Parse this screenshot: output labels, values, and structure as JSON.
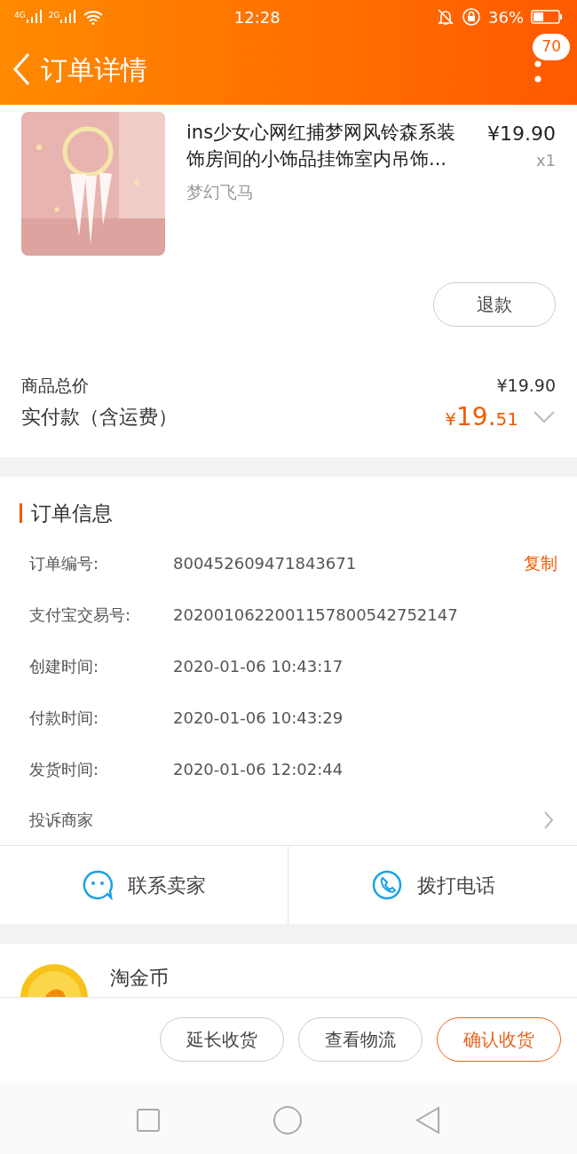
{
  "status_bar": {
    "network_1": "4G",
    "network_2": "2G",
    "time": "12:28",
    "battery": "36%"
  },
  "header": {
    "title": "订单详情",
    "badge": "70"
  },
  "product": {
    "title": "ins少女心网红捕梦网风铃森系装饰房间的小饰品挂饰室内吊饰...",
    "shop": "梦幻飞马",
    "price": "¥19.90",
    "quantity": "x1",
    "refund_button": "退款"
  },
  "totals": {
    "goods_label": "商品总价",
    "goods_value": "¥19.90",
    "paid_label": "实付款（含运费）",
    "paid_currency": "¥",
    "paid_integer": "19.",
    "paid_fraction": "51",
    "expanded": false
  },
  "order_info": {
    "title": "订单信息",
    "rows": [
      {
        "label": "订单编号:",
        "value": "800452609471843671",
        "action": "复制"
      },
      {
        "label": "支付宝交易号:",
        "value": "2020010622001157800542752147"
      },
      {
        "label": "创建时间:",
        "value": "2020-01-06 10:43:17"
      },
      {
        "label": "付款时间:",
        "value": "2020-01-06 10:43:29"
      },
      {
        "label": "发货时间:",
        "value": "2020-01-06 12:02:44"
      }
    ],
    "complaint": "投诉商家",
    "contacts": [
      {
        "kind": "chat",
        "label": "联系卖家"
      },
      {
        "kind": "phone",
        "label": "拨打电话"
      }
    ]
  },
  "coins": {
    "title": "淘金币"
  },
  "actions": [
    {
      "label": "延长收货",
      "primary": false
    },
    {
      "label": "查看物流",
      "primary": false
    },
    {
      "label": "确认收货",
      "primary": true
    }
  ]
}
